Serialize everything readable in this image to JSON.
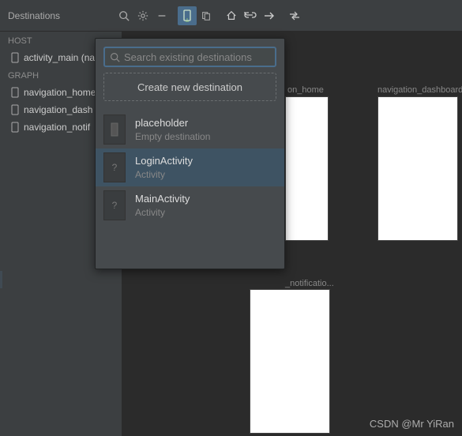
{
  "panel": {
    "title": "Destinations"
  },
  "sections": {
    "host": "HOST",
    "graph": "GRAPH"
  },
  "tree": {
    "host_item": "activity_main (na",
    "graph": [
      "navigation_home",
      "navigation_dash",
      "navigation_notif"
    ]
  },
  "popup": {
    "search_placeholder": "Search existing destinations",
    "create_label": "Create new destination",
    "results": [
      {
        "title": "placeholder",
        "subtitle": "Empty destination"
      },
      {
        "title": "LoginActivity",
        "subtitle": "Activity"
      },
      {
        "title": "MainActivity",
        "subtitle": "Activity"
      }
    ]
  },
  "canvas": {
    "labels": {
      "home": "on_home",
      "dashboard": "navigation_dashboard",
      "notif": "_notificatio..."
    }
  },
  "icons": {
    "search": "search-icon",
    "gear": "gear-icon",
    "minus": "minimize-icon",
    "device": "device-icon",
    "copy": "copy-icon",
    "home": "home-icon",
    "link": "link-icon",
    "arrow": "arrow-icon",
    "swap": "swap-icon"
  },
  "watermark": "CSDN @Mr YiRan"
}
